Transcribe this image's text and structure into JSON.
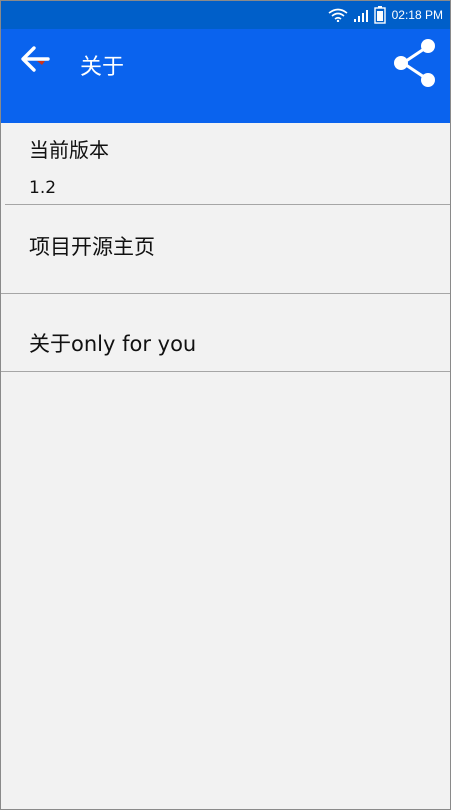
{
  "status_bar": {
    "time": "02:18 PM",
    "icons": [
      "wifi-icon",
      "signal-icon",
      "battery-icon"
    ]
  },
  "toolbar": {
    "title": "关于",
    "back_icon": "back-arrow-icon",
    "share_icon": "share-icon"
  },
  "items": {
    "version_label": "当前版本",
    "version_value": "1.2",
    "homepage_label": "项目开源主页",
    "about_label": "关于only for you"
  },
  "colors": {
    "status_bar": "#005fc9",
    "toolbar": "#0a63ee",
    "background": "#f2f2f2",
    "divider": "#a6a6a6"
  }
}
